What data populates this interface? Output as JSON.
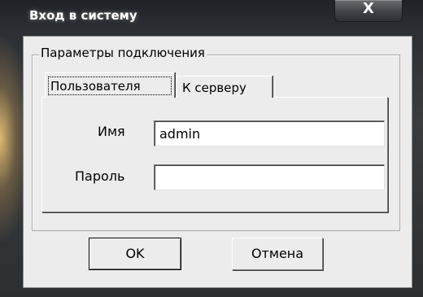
{
  "window": {
    "title": "Вход в систему",
    "close_label": "X"
  },
  "group": {
    "legend": "Параметры подключения"
  },
  "tabs": [
    {
      "label": "Пользователя",
      "selected": true
    },
    {
      "label": "К серверу",
      "selected": false
    }
  ],
  "form": {
    "name_label": "Имя",
    "name_value": "admin",
    "password_label": "Пароль",
    "password_value": ""
  },
  "buttons": {
    "ok": "OK",
    "cancel": "Отмена"
  }
}
